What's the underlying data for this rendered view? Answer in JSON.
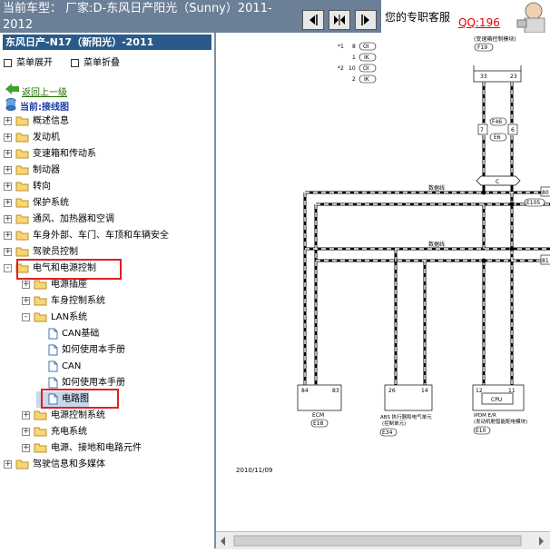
{
  "header": {
    "car_title": "当前车型：  厂家:D-东风日产阳光（Sunny）2011-2012",
    "service_label": "您的专职客服",
    "qq_label": "QQ:196"
  },
  "sidebar": {
    "vehicle": "东风日产-N17（新阳光）-2011",
    "expand_menu": "菜单展开",
    "collapse_menu": "菜单折叠",
    "back": "返回上一级",
    "current": "当前:接线图",
    "tree": [
      {
        "label": "概述信息",
        "level": 0,
        "expander": "+"
      },
      {
        "label": "发动机",
        "level": 0,
        "expander": "+"
      },
      {
        "label": "变速箱和传动系",
        "level": 0,
        "expander": "+"
      },
      {
        "label": "制动器",
        "level": 0,
        "expander": "+"
      },
      {
        "label": "转向",
        "level": 0,
        "expander": "+"
      },
      {
        "label": "保护系统",
        "level": 0,
        "expander": "+"
      },
      {
        "label": "通风、加热器和空调",
        "level": 0,
        "expander": "+"
      },
      {
        "label": "车身外部、车门、车顶和车辆安全",
        "level": 0,
        "expander": "+"
      },
      {
        "label": "驾驶员控制",
        "level": 0,
        "expander": "+"
      },
      {
        "label": "电气和电源控制",
        "level": 0,
        "expander": "-"
      },
      {
        "label": "电源插座",
        "level": 1,
        "expander": "+"
      },
      {
        "label": "车身控制系统",
        "level": 1,
        "expander": "+"
      },
      {
        "label": "LAN系统",
        "level": 1,
        "expander": "-"
      },
      {
        "label": "CAN基础",
        "level": 2,
        "expander": ""
      },
      {
        "label": "如何使用本手册",
        "level": 2,
        "expander": ""
      },
      {
        "label": "CAN",
        "level": 2,
        "expander": ""
      },
      {
        "label": "如何使用本手册",
        "level": 2,
        "expander": ""
      },
      {
        "label": "电路图",
        "level": 2,
        "expander": ""
      },
      {
        "label": "电源控制系统",
        "level": 1,
        "expander": "+"
      },
      {
        "label": "充电系统",
        "level": 1,
        "expander": "+"
      },
      {
        "label": "电源、接地和电路元件",
        "level": 1,
        "expander": "+"
      },
      {
        "label": "驾驶信息和多媒体",
        "level": 0,
        "expander": "+"
      }
    ]
  },
  "diagram": {
    "legend": [
      {
        "mark": "*1",
        "num": "8",
        "code": "OI"
      },
      {
        "mark": "",
        "num": "1",
        "code": "IK"
      },
      {
        "mark": "*2",
        "num": "10",
        "code": "OI"
      },
      {
        "mark": "",
        "num": "2",
        "code": "IK"
      }
    ],
    "top_module": "(变速箱控制模块)",
    "top_connector": "F19",
    "pin_33": "33",
    "pin_23": "23",
    "pin_7": "7",
    "pin_6": "6",
    "f46": "F46",
    "e6": "E6",
    "c_label": "C",
    "dataline1": "数据线",
    "dataline2": "数据线",
    "e105": "E105",
    "pin_80": "80",
    "pin_81": "81",
    "ecm_pin1": "84",
    "ecm_pin2": "83",
    "ecm_name": "ECM",
    "ecm_conn": "E18",
    "abs_pin1": "26",
    "abs_pin2": "14",
    "abs_name1": "ABS 执行器和电气单元",
    "abs_name2": "(控制单元)",
    "abs_conn": "E34",
    "ipdm_pin1": "12",
    "ipdm_pin2": "11",
    "ipdm_cpu": "CPU",
    "ipdm_name1": "IPDM E/R",
    "ipdm_name2": "(发动机舱智能配电模块)",
    "ipdm_conn": "E10",
    "date": "2010/11/09"
  }
}
